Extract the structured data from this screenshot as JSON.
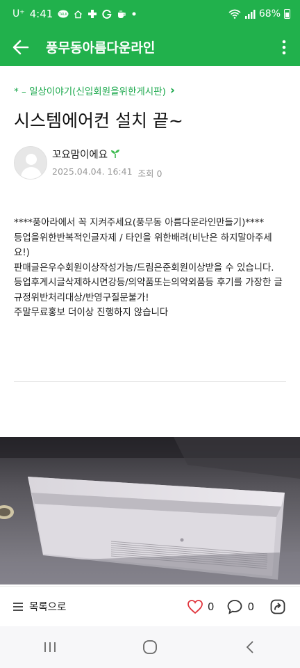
{
  "status_bar": {
    "carrier": "U⁺",
    "time": "4:41",
    "battery": "68%",
    "notification_icons": [
      "talk-icon",
      "home-icon",
      "plus-icon",
      "g-icon",
      "coffee-icon",
      "dot-icon"
    ]
  },
  "header": {
    "title": "풍무동아름다운라인",
    "background": "#21b14c"
  },
  "post": {
    "category": "* – 일상이야기(신입회원을위한게시판)",
    "category_arrow": "›",
    "title": "시스템에어컨 설치 끝~",
    "author": {
      "name": "꼬요맘이에요",
      "badge_icon": "sprout-icon",
      "date": "2025.04.04. 16:41",
      "views_label": "조회 0"
    },
    "body_lines": [
      "****풍아라에서 꼭 지켜주세요(풍무동 아름다운라인만들기)****",
      "등업을위한반복적인글자제 / 타인을 위한배려(비난은 하지말아주세요!)",
      "판매글은우수회원이상작성가능/드림은준회원이상받을 수 있습니다.",
      "등업후게시글삭제하시면강등/의약품또는의약외품등 후기를 가장한 글 규정위반처리대상/반영구질문불가!",
      "주말무료홍보 더이상 진행하지 않습니다"
    ]
  },
  "footer": {
    "list_label": "목록으로",
    "like_count": "0",
    "comment_count": "0"
  },
  "colors": {
    "brand_green": "#21b14c",
    "link_green": "#1aa84b",
    "like_red": "#e0333b"
  }
}
